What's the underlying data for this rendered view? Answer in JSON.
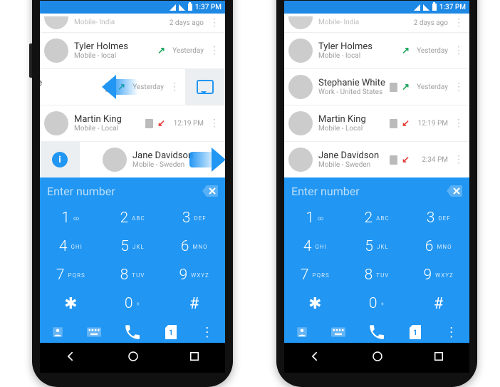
{
  "status": {
    "time": "1:37 PM"
  },
  "rows": {
    "r0": {
      "sub": "Mobile- India",
      "time": "2 days ago"
    },
    "r1": {
      "name": "Tyler Holmes",
      "sub": "Mobile - local",
      "time": "Yesterday"
    },
    "r2": {
      "name": "Stephanie White",
      "sub": "Work - United States",
      "time": "Yesterday",
      "name_cut": "phanie White",
      "sub_cut": "< - United States"
    },
    "r3": {
      "name": "Martin King",
      "sub": "Mobile - Local",
      "time": "12:19 PM"
    },
    "r4": {
      "name": "Jane Davidson",
      "sub": "Mobile - Sweden",
      "time": "2:34 PM"
    }
  },
  "entry": {
    "placeholder": "Enter number"
  },
  "keys": {
    "k1": {
      "n": "1",
      "l": "∞"
    },
    "k2": {
      "n": "2",
      "l": "ABC"
    },
    "k3": {
      "n": "3",
      "l": "DEF"
    },
    "k4": {
      "n": "4",
      "l": "GHI"
    },
    "k5": {
      "n": "5",
      "l": "JKL"
    },
    "k6": {
      "n": "6",
      "l": "MNO"
    },
    "k7": {
      "n": "7",
      "l": "PQRS"
    },
    "k8": {
      "n": "8",
      "l": "TUV"
    },
    "k9": {
      "n": "9",
      "l": "WXYZ"
    },
    "kstar": {
      "n": "✱"
    },
    "k0": {
      "n": "0",
      "l": "+"
    },
    "khash": {
      "n": "#"
    }
  }
}
